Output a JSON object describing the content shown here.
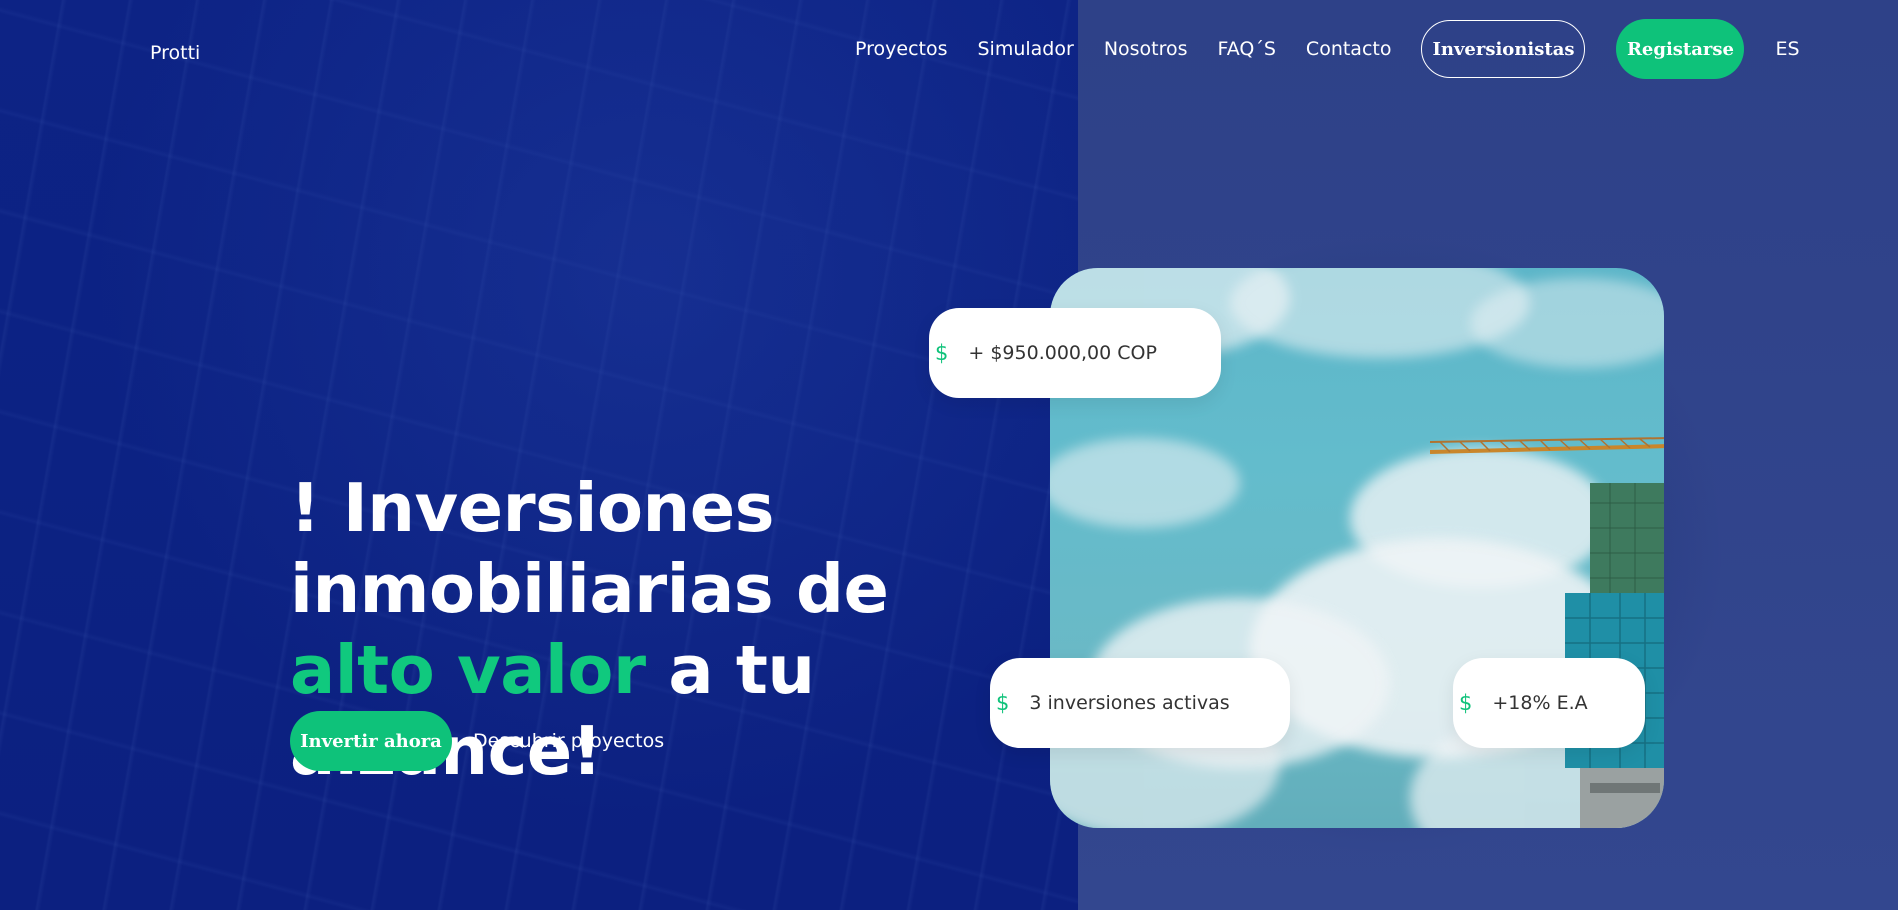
{
  "brand": {
    "logo_text": "Protti"
  },
  "nav": {
    "links": [
      "Proyectos",
      "Simulador",
      "Nosotros",
      "FAQ´S",
      "Contacto"
    ],
    "investors_label": "Inversionistas",
    "register_label": "Registarse",
    "language": "ES"
  },
  "hero": {
    "headline_part1": "! Inversiones inmobiliarias de ",
    "headline_accent": "alto valor",
    "headline_part2": " a tu alzance!",
    "cta_primary": "Invertir ahora",
    "cta_secondary": "Descubrir proyectos"
  },
  "stats": {
    "amount": {
      "icon": "dollar-icon",
      "text": "+ $950.000,00 COP"
    },
    "active": {
      "icon": "dollar-icon",
      "text": "3 inversiones activas"
    },
    "return": {
      "icon": "dollar-icon",
      "text": "+18% E.A"
    }
  },
  "colors": {
    "accent": "#0ec27a",
    "navy": "#0c2283",
    "navy_light": "#2f4189"
  }
}
